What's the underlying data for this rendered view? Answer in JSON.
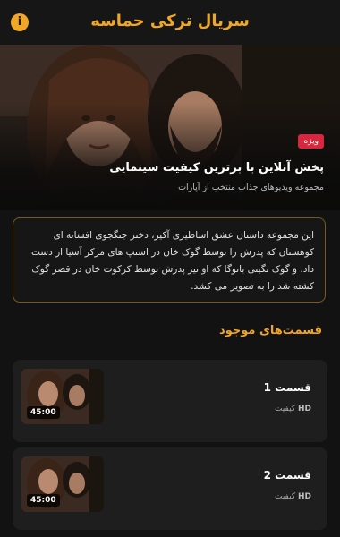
{
  "header": {
    "title": "سریال ترکی حماسه",
    "info_icon": "info-icon",
    "accent_color": "#f0a728"
  },
  "hero": {
    "badge": "ویژه",
    "title": "پخش آنلاین با برترین کیفیت سینمایی",
    "subtitle": "مجموعه ویدیوهای جذاب منتخب از آپارات"
  },
  "description": "این مجموعه داستان عشق اساطیری آکیز، دختر جنگجوی افسانه ای کوهستان که پدرش را توسط گوک خان در استپ های مرکز آسیا از دست داد، و گوک تگینی باتوگا که او نیز پدرش توسط کرکوت خان در قصر گوک کشته شد را به تصویر می کشد.",
  "episodes_section": {
    "title": "قسمت‌های موجود"
  },
  "episodes": [
    {
      "title": "قسمت 1",
      "quality_badge": "HD",
      "quality_label": "کیفیت",
      "duration": "45:00"
    },
    {
      "title": "قسمت 2",
      "quality_badge": "HD",
      "quality_label": "کیفیت",
      "duration": "45:00"
    }
  ]
}
